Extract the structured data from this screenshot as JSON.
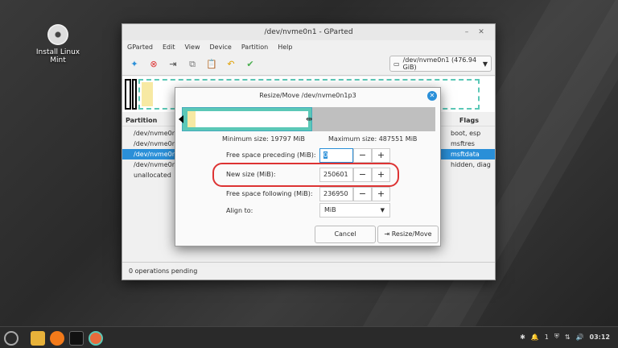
{
  "desktop": {
    "icon_label": "Install Linux Mint"
  },
  "window": {
    "title": "/dev/nvme0n1 - GParted",
    "menu": [
      "GParted",
      "Edit",
      "View",
      "Device",
      "Partition",
      "Help"
    ],
    "device_selector": "/dev/nvme0n1 (476.94 GiB)",
    "columns": {
      "partition": "Partition",
      "flags": "Flags"
    },
    "rows": [
      {
        "name": "/dev/nvme0n1",
        "flags": "boot, esp"
      },
      {
        "name": "/dev/nvme0n1",
        "flags": "msftres"
      },
      {
        "name": "/dev/nvme0n1",
        "flags": "msftdata"
      },
      {
        "name": "/dev/nvme0n1",
        "flags": "hidden, diag"
      },
      {
        "name": "unallocated",
        "flags": ""
      }
    ],
    "status": "0 operations pending"
  },
  "dialog": {
    "title": "Resize/Move /dev/nvme0n1p3",
    "min_size": "Minimum size: 19797 MiB",
    "max_size": "Maximum size: 487551 MiB",
    "fields": {
      "preceding": {
        "label": "Free space preceding (MiB):",
        "value": "0"
      },
      "new_size": {
        "label": "New size (MiB):",
        "value": "250601"
      },
      "following": {
        "label": "Free space following (MiB):",
        "value": "236950"
      },
      "align": {
        "label": "Align to:",
        "value": "MiB"
      }
    },
    "cancel": "Cancel",
    "resize": "Resize/Move",
    "partition_fraction": 0.514
  },
  "taskbar": {
    "clock": "03:12",
    "notif_count": "1"
  },
  "colors": {
    "accent": "#2a8fd8",
    "partition": "#5bc8b7",
    "highlight": "#d33333"
  }
}
